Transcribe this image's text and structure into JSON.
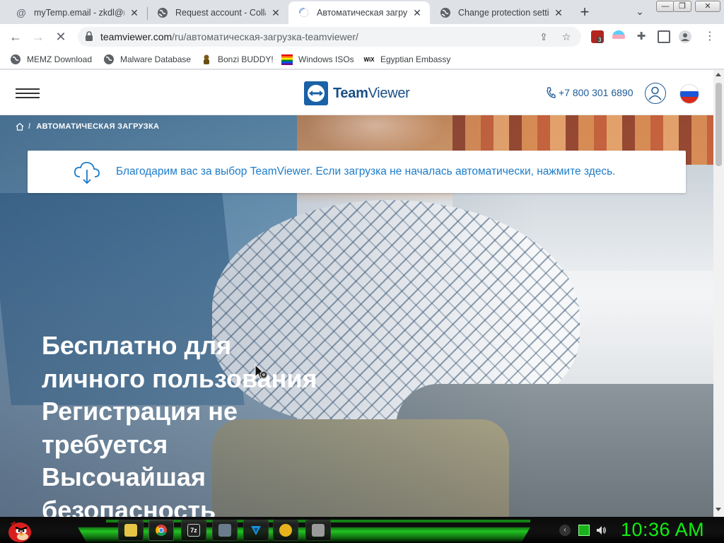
{
  "tabs": [
    {
      "title": "myTemp.email - zkdl@ne",
      "favicon": "at-sign-icon",
      "active": false
    },
    {
      "title": "Request account - Collab",
      "favicon": "globe-icon",
      "active": false
    },
    {
      "title": "Автоматическая загрузк",
      "favicon": "loading-spinner-icon",
      "active": true
    },
    {
      "title": "Change protection settin",
      "favicon": "globe-icon",
      "active": false
    }
  ],
  "toolbar": {
    "url_host": "teamviewer.com",
    "url_path": "/ru/автоматическая-загрузка-teamviewer/",
    "extension_badge": "3"
  },
  "bookmarks": [
    {
      "label": "MEMZ Download",
      "icon": "globe-icon"
    },
    {
      "label": "Malware Database",
      "icon": "globe-icon"
    },
    {
      "label": "Bonzi BUDDY!",
      "icon": "bonzi-icon"
    },
    {
      "label": "Windows ISOs",
      "icon": "windows-flag-icon"
    },
    {
      "label": "Egyptian Embassy",
      "icon": "wix-icon",
      "icon_text": "WiX"
    }
  ],
  "site": {
    "logo_bold": "Team",
    "logo_light": "Viewer",
    "phone": "+7 800 301 6890",
    "breadcrumb_current": "АВТОМАТИЧЕСКАЯ ЗАГРУЗКА",
    "breadcrumb_sep": "/",
    "notice_text": "Благодарим вас за выбор TeamViewer. Если загрузка не началась автоматически, нажмите здесь.",
    "headline_lines": [
      "Бесплатно для",
      "личного пользования",
      "Регистрация не",
      "требуется",
      "Высочайшая",
      "безопасность"
    ]
  },
  "taskbar": {
    "clock": "10:36 AM",
    "apps": [
      {
        "name": "file-explorer-icon",
        "color": "#e8c547",
        "label": ""
      },
      {
        "name": "chrome-icon",
        "color": "#db4437",
        "label": ""
      },
      {
        "name": "7zip-icon",
        "color": "#222222",
        "label": "7z"
      },
      {
        "name": "remote-desktop-icon",
        "color": "#6a7b8c",
        "label": ""
      },
      {
        "name": "vpn-icon",
        "color": "#1b8fd6",
        "label": ""
      },
      {
        "name": "bonzi-app-icon",
        "color": "#e8b21e",
        "label": ""
      },
      {
        "name": "paint-icon",
        "color": "#9a9a9a",
        "label": ""
      }
    ]
  },
  "colors": {
    "accent_blue": "#1d7cc9",
    "teamviewer_navy": "#1a4f85",
    "clock_green": "#11ee11"
  }
}
